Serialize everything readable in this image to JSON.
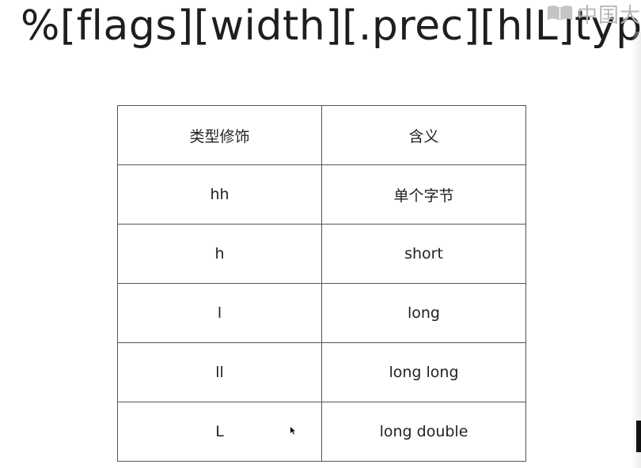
{
  "title": "%[flags][width][.prec][hlL]type",
  "watermark": {
    "text": "中国大",
    "icon": "open-book-logo-icon"
  },
  "table": {
    "headers": [
      "类型修饰",
      "含义"
    ],
    "rows": [
      [
        "hh",
        "单个字节"
      ],
      [
        "h",
        "short"
      ],
      [
        "l",
        "long"
      ],
      [
        "ll",
        "long long"
      ],
      [
        "L",
        "long double"
      ]
    ]
  },
  "cursor_icon": "mouse-pointer-icon"
}
